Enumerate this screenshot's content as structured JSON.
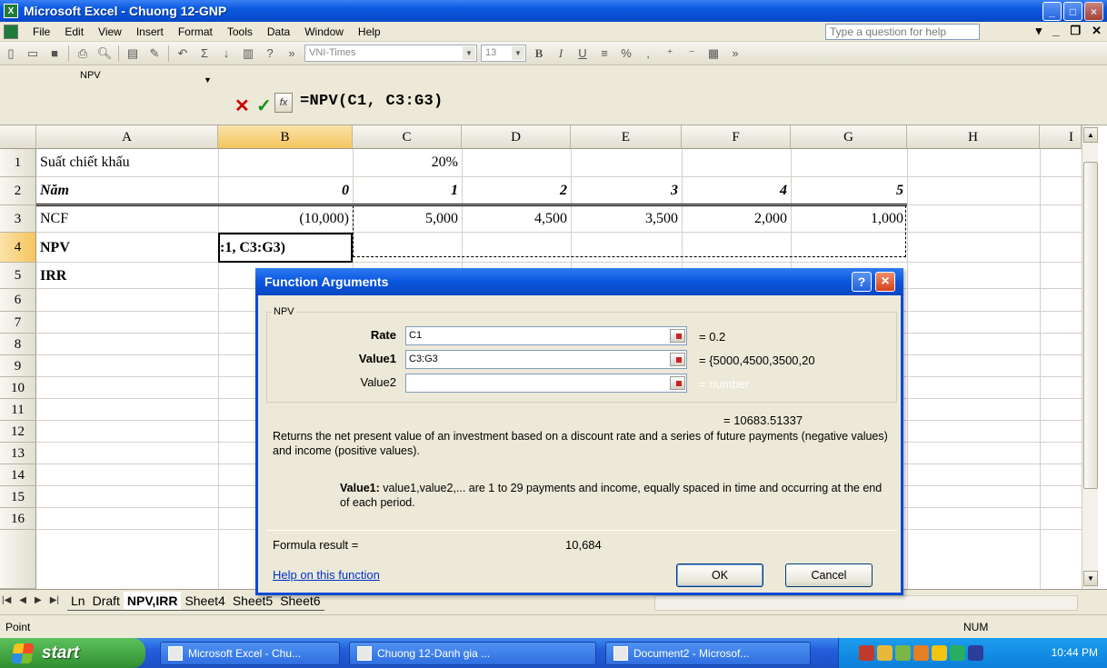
{
  "window": {
    "title": "Microsoft Excel - Chuong 12-GNP",
    "controls": [
      "_",
      "□",
      "×"
    ]
  },
  "menu": {
    "items": [
      "File",
      "Edit",
      "View",
      "Insert",
      "Format",
      "Tools",
      "Data",
      "Window",
      "Help"
    ],
    "help_placeholder": "Type a question for help"
  },
  "toolbar": {
    "font": "VNI-Times",
    "font_size": "13",
    "bold_label": "B",
    "italic_label": "I",
    "underline_label": "U",
    "percent_label": "%"
  },
  "formula_bar": {
    "name_box": "NPV",
    "fx_label": "fx",
    "formula": "=NPV(C1, C3:G3)"
  },
  "sheet": {
    "columns": [
      "A",
      "B",
      "C",
      "D",
      "E",
      "F",
      "G",
      "H",
      "I"
    ],
    "rows": [
      "1",
      "2",
      "3",
      "4",
      "5",
      "6",
      "7",
      "8",
      "9",
      "10",
      "11",
      "12",
      "13",
      "14",
      "15",
      "16"
    ],
    "cells": {
      "A1": "Suất chiết khấu",
      "C1": "20%",
      "A2": "Năm",
      "B2": "0",
      "C2": "1",
      "D2": "2",
      "E2": "3",
      "F2": "4",
      "G2": "5",
      "A3": "NCF",
      "B3": "(10,000)",
      "C3": "5,000",
      "D3": "4,500",
      "E3": "3,500",
      "F3": "2,000",
      "G3": "1,000",
      "A4": "NPV",
      "B4": ":1, C3:G3)",
      "A5": "IRR"
    }
  },
  "tabs": {
    "sheets": [
      "Ln",
      "Draft",
      "NPV,IRR",
      "Sheet4",
      "Sheet5",
      "Sheet6"
    ],
    "active": "NPV,IRR"
  },
  "status": {
    "mode": "Point",
    "num": "NUM"
  },
  "taskbar": {
    "start": "start",
    "items": [
      "Microsoft Excel - Chu...",
      "Chuong 12-Danh gia ...",
      "Document2 - Microsof..."
    ],
    "clock": "10:44 PM"
  },
  "dialog": {
    "title": "Function Arguments",
    "function_name": "NPV",
    "args": [
      {
        "label": "Rate",
        "value": "C1",
        "result": "= 0.2"
      },
      {
        "label": "Value1",
        "value": "C3:G3",
        "result": "= {5000,4500,3500,20"
      },
      {
        "label": "Value2",
        "value": "",
        "result": "= number"
      }
    ],
    "total": "= 10683.51337",
    "description": "Returns the net present value of an investment based on a discount rate and a series of future payments (negative values) and income (positive values).",
    "arg_desc_label": "Value1:",
    "arg_desc_text": "value1,value2,... are 1 to 29 payments and income, equally spaced in time and occurring at the end of each period.",
    "formula_result_label": "Formula result =",
    "formula_result_value": "10,684",
    "help_link": "Help on this function",
    "ok": "OK",
    "cancel": "Cancel",
    "help_btn": "?",
    "close_btn": "×"
  }
}
